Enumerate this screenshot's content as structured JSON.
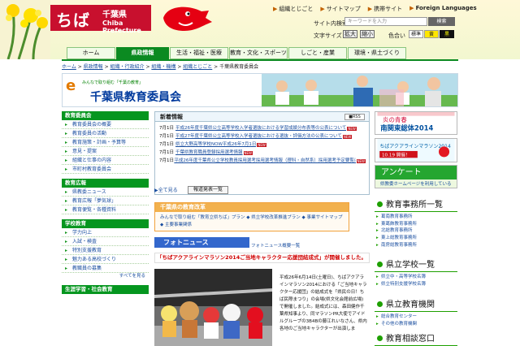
{
  "site": {
    "logo_text": "ちば",
    "logo_jp": "千葉県",
    "logo_en": "Chiba Prefecture",
    "mascot_icon": "chiba-kun-mascot-icon"
  },
  "utility": {
    "items": [
      "組織とじごと",
      "サイトマップ",
      "携帯サイト",
      "Foreign Languages"
    ],
    "search_label": "サイト内検索",
    "search_placeholder": "キーワードを入力",
    "search_button": "検索",
    "text_size_label": "文字サイズ",
    "large": "拡大",
    "small": "縮小",
    "color_label": "色合い",
    "standard": "標準",
    "yellow": "黄",
    "black": "黒"
  },
  "nav": {
    "items": [
      "ホーム",
      "県政情報",
      "生活・福祉・医療",
      "教育・文化・スポーツ",
      "しごと・産業",
      "環境・県土づくり"
    ],
    "active": "県政情報"
  },
  "breadcrumb": {
    "items": [
      "ホーム",
      "県政情報",
      "組織・行政紹介",
      "組織・機構",
      "組織とじごと",
      "千葉県教育委員会"
    ]
  },
  "page": {
    "title": "千葉県教育委員会",
    "subtitle": "みんなで取り組む「千葉の教育」",
    "title_logo": "e"
  },
  "sidebar": {
    "sections": [
      {
        "title": "教育委員会",
        "items": [
          "教育委員会の概要",
          "教育委員の活動",
          "教育施策・計画・予算等",
          "意見・提案",
          "組織と仕事の内容",
          "市町村教育委員会"
        ]
      },
      {
        "title": "教育広報",
        "items": [
          "県教委ニュース",
          "教育広報「夢気球」",
          "教育便覧・各種資料"
        ]
      },
      {
        "title": "学校教育",
        "items": [
          "学力向上",
          "入試・検査",
          "特別支援教育",
          "魅力ある高校づくり",
          "教職員の募集"
        ],
        "all": "すべてを見る"
      },
      {
        "title": "生涯学習・社会教育",
        "items": []
      }
    ]
  },
  "news": {
    "title": "新着情報",
    "rss": "RSS",
    "items": [
      {
        "date": "7月1日",
        "title": "平成26年度千葉県公立高等学校入学者選抜における学習成績分布表等の公表について",
        "new": "NEW"
      },
      {
        "date": "7月1日",
        "title": "平成27年度千葉県公立高等学校入学者選抜における選抜・評価方法の公表について",
        "new": "NEW"
      },
      {
        "date": "7月1日",
        "title": "県立大野高等学校NOW平成26年7月1日",
        "new": "NEW"
      },
      {
        "date": "7月1日",
        "title": "千葉県教育職員登録採用選考情報",
        "new": "NEW"
      },
      {
        "date": "7月1日",
        "title": "平成26年度千葉県公立学校教員採用選考採用選考情報（理科・自然系）採用選考予定要覧について",
        "new": "NEW"
      }
    ],
    "more": "全て見る",
    "press": "報道発表一覧"
  },
  "reform": {
    "title": "千葉県の教育改革",
    "links": [
      "みんなで取り組む「教育立県ちば」プラン",
      "県立学校改革推進プラン",
      "事業サイトマップ",
      "主要事業関係"
    ]
  },
  "photo": {
    "title": "フォトニュース",
    "list_link": "フォトニュース概要一覧",
    "headline": "「ちばアクアラインマラソン2014ご当地キャラクター応援団結成式」が開催しました。",
    "text": "平成26年6月14日(土曜日)、ちばアクアラインマラソン2014における「ご当地キャラクター応援団」の結成式を「県民の日！ちば民際まつり」の会場(県文化会館前広場)で開催しました。結成式には、森田健作千葉県知事より、同マラソンPR大使でアイドルグループの3B4Bの藤江れいなさん、県内各地のご当地キャラクターが出演しま"
  },
  "right": {
    "ads": [
      "南関東総体2014",
      "ちばアクアラインマラソン2014"
    ],
    "ad_sub": "10.19 開催！",
    "questionnaire_title": "アンケート",
    "questionnaire_text": "県教委ホームページを利用している方ぜひアンケートにご協力ください",
    "office_title": "教育事務所一覧",
    "offices": [
      "葛南教育事務所",
      "東葛飾教育事務所",
      "北総教育事務所",
      "東上総教育事務所",
      "南房総教育事務所"
    ],
    "schools_title": "県立学校一覧",
    "schools": [
      "県立中・高等学校名簿",
      "県立特別支援学校名簿"
    ],
    "institutions_title": "県立教育機関",
    "institutions": [
      "総合教育センター",
      "その他の教育機関"
    ],
    "consult_title": "教育相談窓口"
  },
  "colors": {
    "green": "#0b8a21",
    "red": "#c8102e",
    "blue": "#1b4fa0",
    "orange": "#f2b14e"
  }
}
